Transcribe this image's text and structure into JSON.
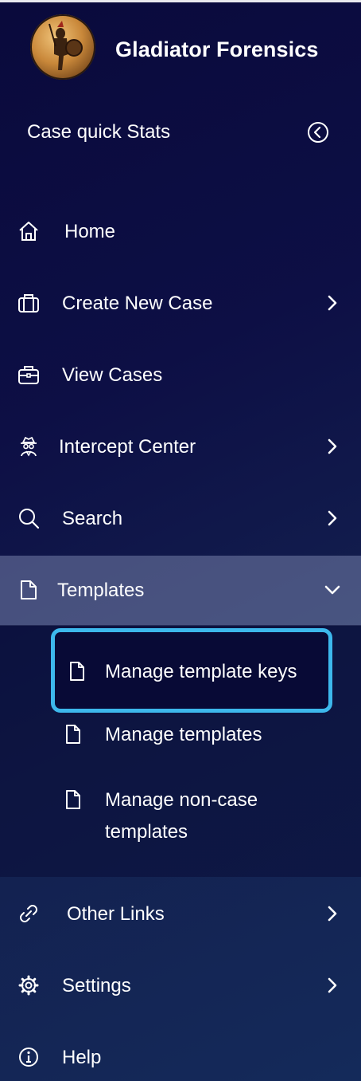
{
  "brand": {
    "title": "Gladiator Forensics"
  },
  "quick_stats": {
    "label": "Case quick Stats"
  },
  "nav": {
    "home": "Home",
    "create_case": "Create New Case",
    "view_cases": "View Cases",
    "intercept_center": "Intercept Center",
    "search": "Search",
    "templates": "Templates",
    "other_links": "Other Links",
    "settings": "Settings",
    "help": "Help"
  },
  "templates_submenu": {
    "manage_keys": "Manage template keys",
    "manage_templates": "Manage templates",
    "manage_non_case": "Manage non-case templates"
  },
  "colors": {
    "highlight_border": "#3db8ec",
    "active_row": "#5d6792"
  }
}
